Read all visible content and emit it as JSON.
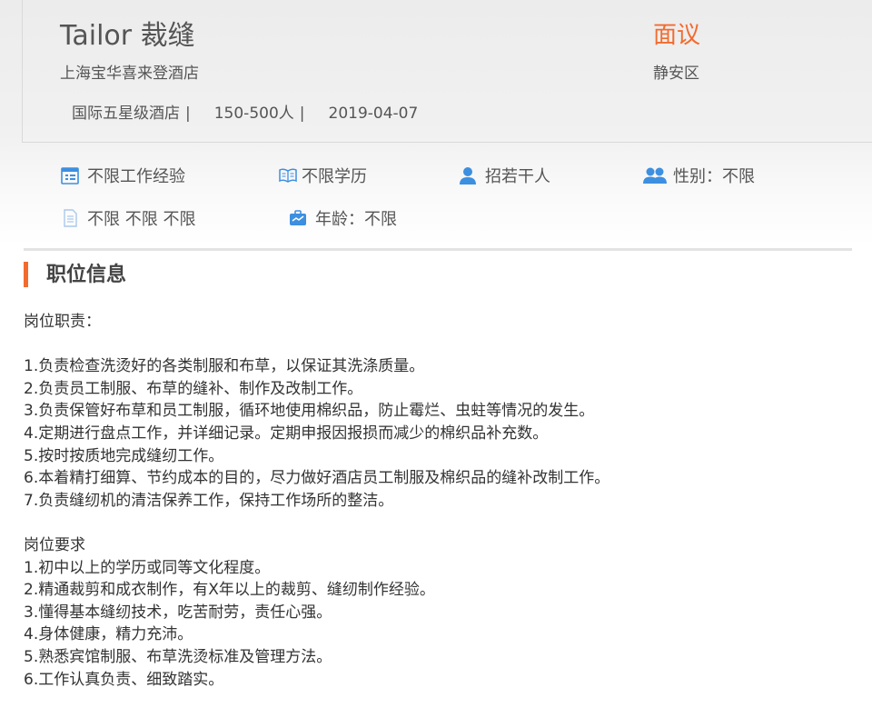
{
  "job": {
    "title": "Tailor 裁缝",
    "company": "上海宝华喜来登酒店",
    "meta": {
      "type": "国际五星级酒店",
      "size": "150-500人",
      "date": "2019-04-07",
      "separator": "|"
    },
    "salary": "面议",
    "district": "静安区"
  },
  "requirements": {
    "experience": "不限工作经验",
    "education": "不限学历",
    "headcount": "招若干人",
    "gender": "性别：不限",
    "misc": "不限 不限 不限",
    "age": "年龄：不限"
  },
  "icons": {
    "experience": "calendar-icon",
    "education": "book-icon",
    "headcount": "person-icon",
    "gender": "people-icon",
    "misc": "document-icon",
    "age": "briefcase-icon"
  },
  "colors": {
    "accent": "#f26b2e",
    "icon_blue": "#3d8fe0"
  },
  "section": {
    "title": "职位信息"
  },
  "duties": {
    "heading": "岗位职责：",
    "items": [
      "1.负责检查洗烫好的各类制服和布草，以保证其洗涤质量。",
      "2.负责员工制服、布草的缝补、制作及改制工作。",
      "3.负责保管好布草和员工制服，循环地使用棉织品，防止霉烂、虫蛀等情况的发生。",
      "4.定期进行盘点工作，并详细记录。定期申报因报损而减少的棉织品补充数。",
      "5.按时按质地完成缝纫工作。",
      "6.本着精打细算、节约成本的目的，尽力做好酒店员工制服及棉织品的缝补改制工作。",
      "7.负责缝纫机的清洁保养工作，保持工作场所的整洁。"
    ]
  },
  "qualifications": {
    "heading": "岗位要求",
    "items": [
      "1.初中以上的学历或同等文化程度。",
      "2.精通裁剪和成衣制作，有X年以上的裁剪、缝纫制作经验。",
      "3.懂得基本缝纫技术，吃苦耐劳，责任心强。",
      "4.身体健康，精力充沛。",
      "5.熟悉宾馆制服、布草洗烫标准及管理方法。",
      "6.工作认真负责、细致踏实。"
    ]
  }
}
